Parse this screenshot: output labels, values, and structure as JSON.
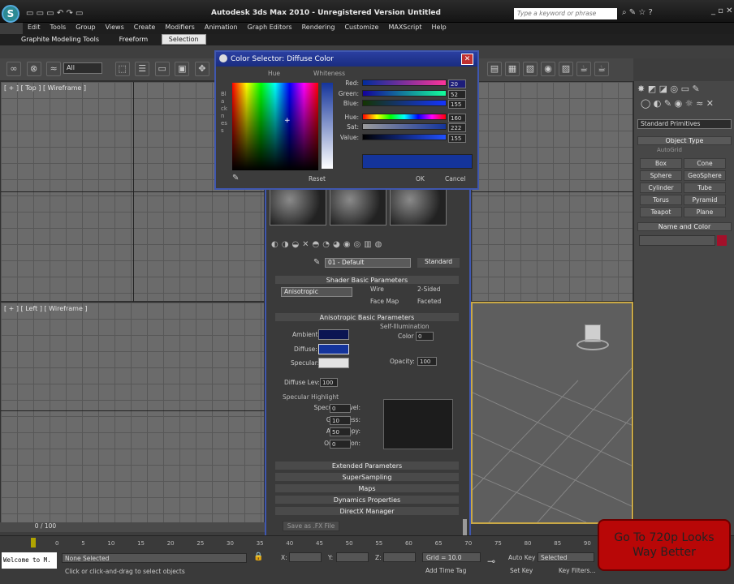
{
  "window": {
    "title": "Autodesk 3ds Max  2010    - Unregistered Version    Untitled",
    "search_placeholder": "Type a keyword or phrase"
  },
  "menu": [
    "Edit",
    "Tools",
    "Group",
    "Views",
    "Create",
    "Modifiers",
    "Animation",
    "Graph Editors",
    "Rendering",
    "Customize",
    "MAXScript",
    "Help"
  ],
  "ribbon_tabs": [
    "Graphite Modeling Tools",
    "Freeform",
    "Selection"
  ],
  "toolbar": {
    "filter": "All"
  },
  "viewports": {
    "top": "[ + ] [ Top ] [ Wireframe ]",
    "left": "[ + ] [ Left ] [ Wireframe ]"
  },
  "color_dialog": {
    "title": "Color Selector: Diffuse Color",
    "hue_label": "Hue",
    "whiteness_label": "Whiteness",
    "blackness_label": "Blackness",
    "channels": [
      {
        "label": "Red:",
        "value": "20",
        "color": "#e0206e"
      },
      {
        "label": "Green:",
        "value": "52",
        "color": "#20c0a0"
      },
      {
        "label": "Blue:",
        "value": "155",
        "color": "#2060ff"
      },
      {
        "label": "Hue:",
        "value": "160",
        "color": "#ff0000"
      },
      {
        "label": "Sat:",
        "value": "222",
        "color": "#3050c0"
      },
      {
        "label": "Value:",
        "value": "155",
        "color": "#2040e0"
      }
    ],
    "reset": "Reset",
    "ok": "OK",
    "cancel": "Cancel",
    "swatch_color": "#14349b"
  },
  "material": {
    "slot_name": "01 - Default",
    "type": "Standard",
    "sections": {
      "shader": "Shader Basic Parameters",
      "aniso": "Anisotropic Basic Parameters",
      "self_illum": "Self-Illumination",
      "spec_highlight": "Specular Highlight"
    },
    "shader": "Anisotropic",
    "checks": [
      "Wire",
      "2-Sided",
      "Face Map",
      "Faceted"
    ],
    "ambient": "Ambient:",
    "diffuse": "Diffuse:",
    "specular": "Specular:",
    "color_label": "Color",
    "color_val": "0",
    "opacity_label": "Opacity:",
    "opacity_val": "100",
    "diffuse_lev_label": "Diffuse Lev:",
    "diffuse_lev_val": "100",
    "spec_rows": [
      {
        "label": "Specular Level:",
        "value": "0"
      },
      {
        "label": "Glossiness:",
        "value": "10"
      },
      {
        "label": "Anisotropy:",
        "value": "50"
      },
      {
        "label": "Orientation:",
        "value": "0"
      }
    ],
    "rollouts": [
      "Extended Parameters",
      "SuperSampling",
      "Maps",
      "Dynamics Properties",
      "DirectX Manager"
    ],
    "save_fx": "Save as .FX File"
  },
  "cmdpanel": {
    "dropdown": "Standard Primitives",
    "object_type": "Object Type",
    "autogrid": "AutoGrid",
    "buttons": [
      "Box",
      "Cone",
      "Sphere",
      "GeoSphere",
      "Cylinder",
      "Tube",
      "Torus",
      "Pyramid",
      "Teapot",
      "Plane"
    ],
    "name_color": "Name and Color"
  },
  "status": {
    "frame": "0 / 100",
    "none_selected": "None Selected",
    "hint": "Click or click-and-drag to select objects",
    "welcome": "Welcome to M.",
    "grid": "Grid = 10.0",
    "autokey": "Auto Key",
    "setkey": "Set Key",
    "selected": "Selected",
    "keyfilters": "Key Filters...",
    "addtimetag": "Add Time Tag",
    "x": "X:",
    "y": "Y:",
    "z": "Z:",
    "ticks": [
      "0",
      "5",
      "10",
      "15",
      "20",
      "25",
      "30",
      "35",
      "40",
      "45",
      "50",
      "55",
      "60",
      "65",
      "70",
      "75",
      "80",
      "85",
      "90"
    ]
  },
  "promo": {
    "line1": "Go To 720p Looks",
    "line2": "Way Better"
  }
}
